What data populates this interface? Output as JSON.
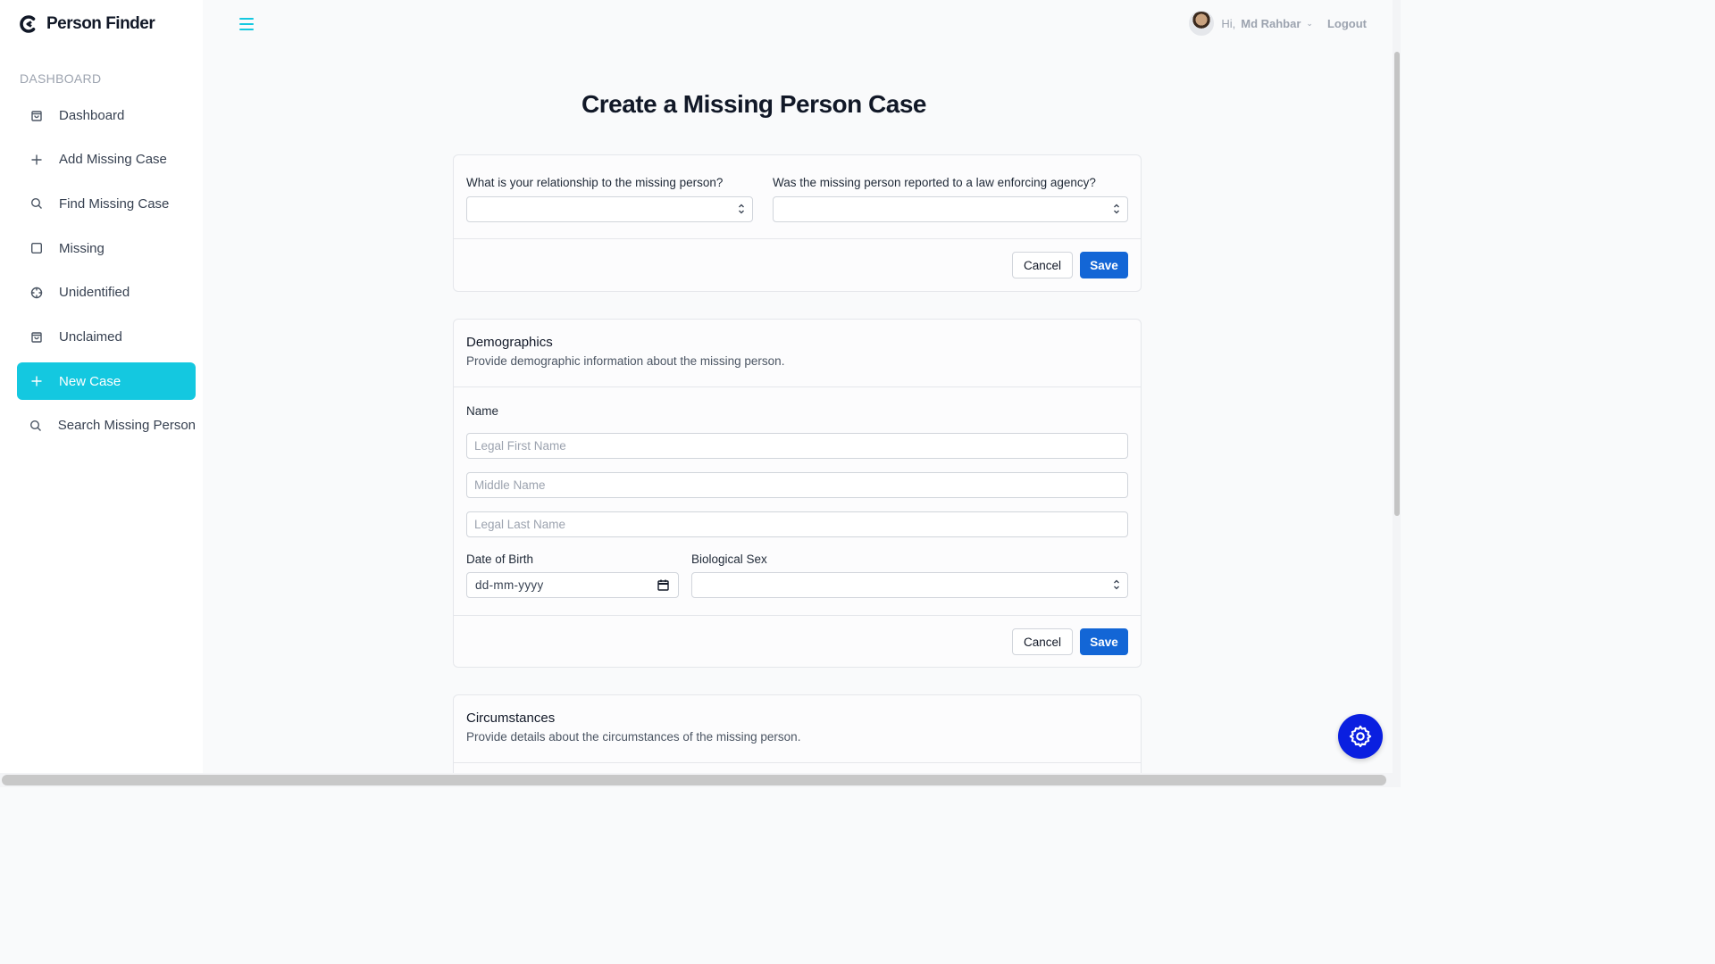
{
  "brand": {
    "name": "Person Finder",
    "icon": "brand-c-icon"
  },
  "sidebar": {
    "section_label": "DASHBOARD",
    "items": [
      {
        "label": "Dashboard",
        "icon": "shopping-bag-icon",
        "active": false
      },
      {
        "label": "Add Missing Case",
        "icon": "plus-icon",
        "active": false
      },
      {
        "label": "Find Missing Case",
        "icon": "search-icon",
        "active": false
      },
      {
        "label": "Missing",
        "icon": "square-icon",
        "active": false
      },
      {
        "label": "Unidentified",
        "icon": "crosshair-icon",
        "active": false
      },
      {
        "label": "Unclaimed",
        "icon": "shopping-bag-icon",
        "active": false
      },
      {
        "label": "New Case",
        "icon": "plus-icon",
        "active": true
      },
      {
        "label": "Search Missing Person",
        "icon": "search-icon",
        "active": false
      }
    ]
  },
  "header": {
    "greeting": "Hi,",
    "user_name": "Md Rahbar",
    "logout_label": "Logout"
  },
  "main": {
    "title": "Create a Missing Person Case",
    "relationship_card": {
      "relationship_label": "What is your relationship to the missing person?",
      "relationship_value": "",
      "reported_label": "Was the missing person reported to a law enforcing agency?",
      "reported_value": "",
      "cancel_label": "Cancel",
      "save_label": "Save"
    },
    "demographics_card": {
      "title": "Demographics",
      "subtitle": "Provide demographic information about the missing person.",
      "name_label": "Name",
      "first_name_placeholder": "Legal First Name",
      "middle_name_placeholder": "Middle Name",
      "last_name_placeholder": "Legal Last Name",
      "dob_label": "Date of Birth",
      "dob_placeholder": "dd-mm-yyyy",
      "sex_label": "Biological Sex",
      "sex_value": "",
      "cancel_label": "Cancel",
      "save_label": "Save"
    },
    "circumstances_card": {
      "title": "Circumstances",
      "subtitle": "Provide details about the circumstances of the missing person."
    }
  },
  "colors": {
    "accent": "#14c8e0",
    "primary_button": "#1366d6",
    "fab": "#0a1fe0"
  }
}
